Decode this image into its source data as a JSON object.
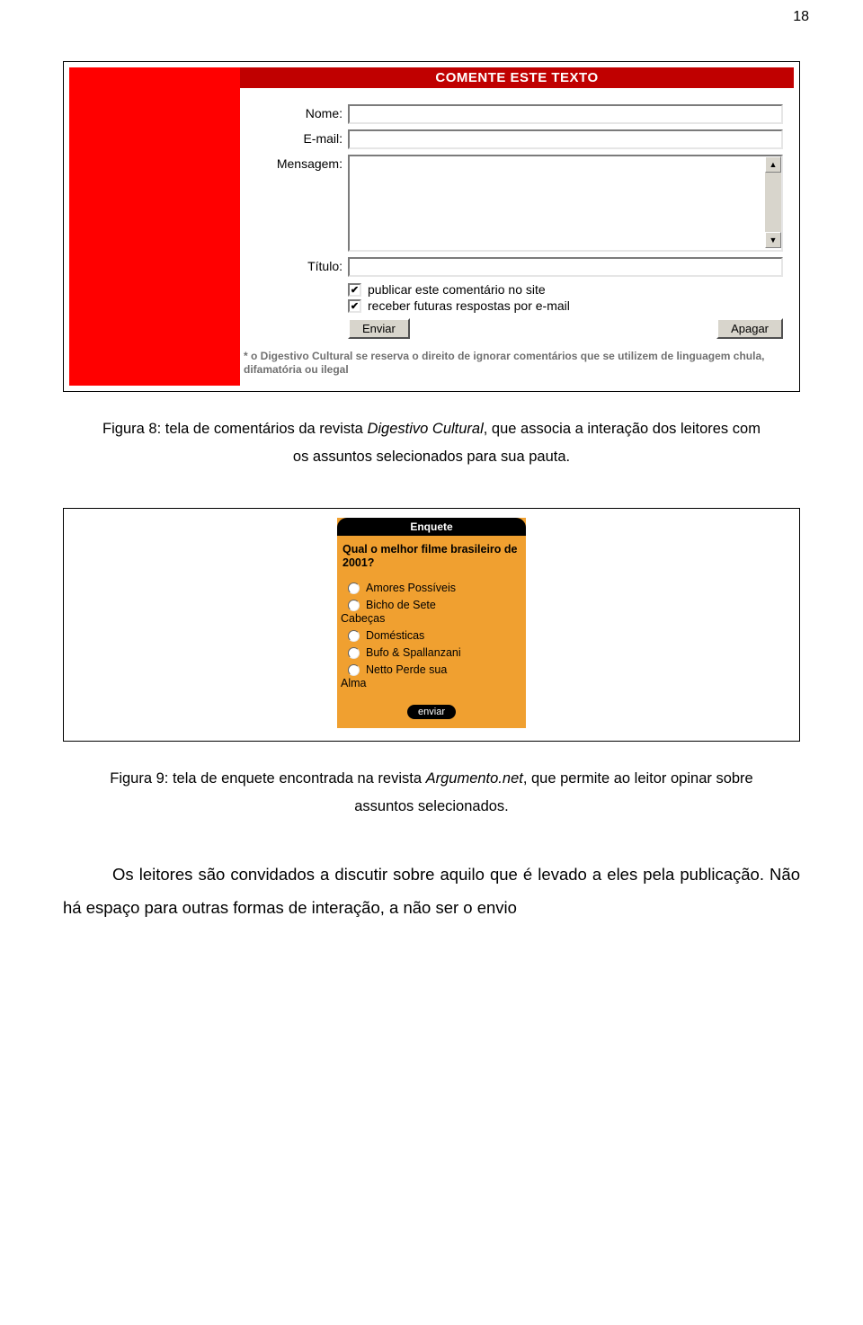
{
  "page_number": "18",
  "figure8": {
    "header": "COMENTE ESTE TEXTO",
    "labels": {
      "nome": "Nome:",
      "email": "E-mail:",
      "mensagem": "Mensagem:",
      "titulo": "Título:"
    },
    "checkboxes": {
      "publicar": "publicar este comentário no site",
      "receber": "receber futuras respostas por e-mail"
    },
    "buttons": {
      "enviar": "Enviar",
      "apagar": "Apagar"
    },
    "disclaimer": "* o Digestivo Cultural se reserva o direito de ignorar comentários que se utilizem de linguagem chula, difamatória ou ilegal"
  },
  "caption8": {
    "prefix": "Figura 8: tela de comentários da revista ",
    "italic": "Digestivo Cultural",
    "suffix": ", que associa a interação dos leitores com",
    "line2": "os assuntos selecionados para sua pauta."
  },
  "enquete": {
    "header": "Enquete",
    "question": "Qual o melhor filme brasileiro de 2001?",
    "options": [
      "Amores Possíveis",
      "Bicho de Sete Cabeças",
      "Domésticas",
      "Bufo & Spallanzani",
      "Netto Perde sua Alma"
    ],
    "send": "enviar"
  },
  "caption9": {
    "prefix": "Figura 9: tela de enquete encontrada na revista ",
    "italic": "Argumento.net",
    "suffix": ", que permite ao leitor opinar sobre",
    "line2": "assuntos selecionados."
  },
  "body": {
    "p1": "Os leitores são convidados a discutir sobre aquilo que é levado a eles pela publicação. Não há espaço para outras formas de interação, a não ser o envio"
  }
}
